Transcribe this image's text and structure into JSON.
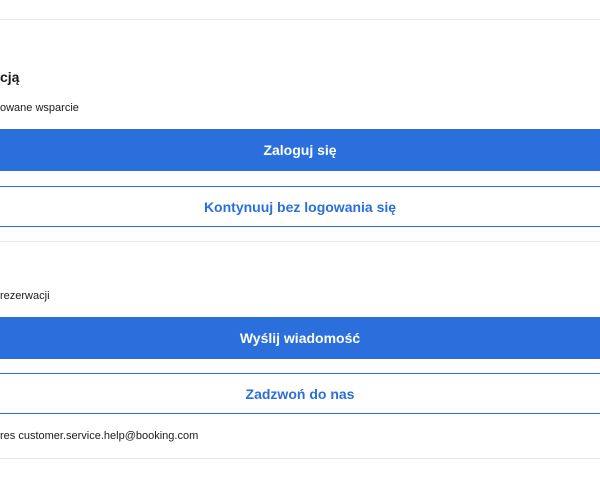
{
  "booking_section": {
    "title_partial": "cją",
    "subtitle_partial": "owane wsparcie",
    "login_button": "Zaloguj się",
    "continue_button": "Kontynuuj bez logowania się"
  },
  "contact_section": {
    "subtitle_partial": "rezerwacji",
    "message_button": "Wyślij wiadomość",
    "call_button": "Zadzwoń do nas",
    "email_note_partial": "res customer.service.help@booking.com"
  },
  "colors": {
    "accent": "#2a6fdb",
    "divider": "#e7e7e7"
  }
}
